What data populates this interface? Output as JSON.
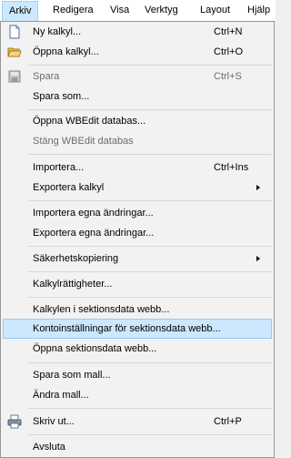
{
  "menubar": {
    "items": [
      "Arkiv",
      "Redigera",
      "Visa",
      "Verktyg",
      "Layout",
      "Hjälp"
    ]
  },
  "menu": {
    "items": [
      {
        "label": "Ny kalkyl...",
        "shortcut": "Ctrl+N",
        "icon": "new-document-icon"
      },
      {
        "label": "Öppna kalkyl...",
        "shortcut": "Ctrl+O",
        "icon": "open-folder-icon"
      },
      {
        "label": "Spara",
        "shortcut": "Ctrl+S",
        "icon": "save-icon",
        "disabled": true
      },
      {
        "label": "Spara som..."
      },
      {
        "label": "Öppna WBEdit databas..."
      },
      {
        "label": "Stäng WBEdit databas",
        "disabled": true
      },
      {
        "label": "Importera...",
        "shortcut": "Ctrl+Ins"
      },
      {
        "label": "Exportera kalkyl",
        "submenu": true
      },
      {
        "label": "Importera egna ändringar..."
      },
      {
        "label": "Exportera egna ändringar..."
      },
      {
        "label": "Säkerhetskopiering",
        "submenu": true
      },
      {
        "label": "Kalkylrättigheter..."
      },
      {
        "label": "Kalkylen i sektionsdata webb..."
      },
      {
        "label": "Kontoinställningar för sektionsdata webb...",
        "highlighted": true
      },
      {
        "label": "Öppna sektionsdata webb..."
      },
      {
        "label": "Spara som mall..."
      },
      {
        "label": "Ändra mall..."
      },
      {
        "label": "Skriv ut...",
        "shortcut": "Ctrl+P",
        "icon": "printer-icon"
      },
      {
        "label": "Avsluta"
      }
    ]
  },
  "colors": {
    "highlight": "#cce8ff",
    "highlight_border": "#99c9ef",
    "disabled_text": "#6d6d6d"
  }
}
